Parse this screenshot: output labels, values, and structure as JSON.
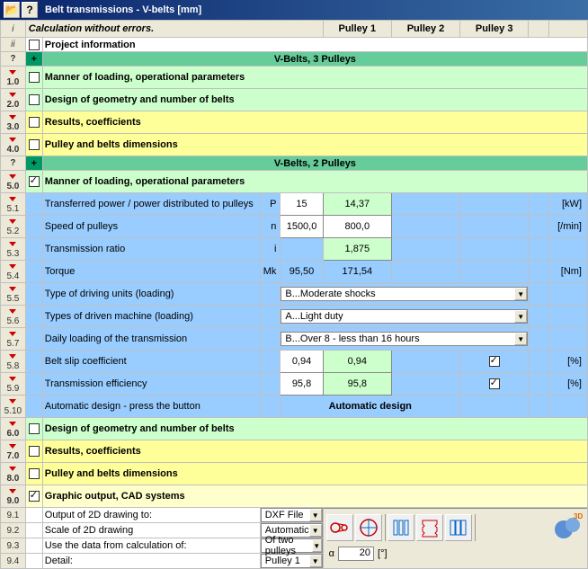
{
  "title": "Belt transmissions - V-belts [mm]",
  "header": {
    "status": "Calculation without errors.",
    "p1": "Pulley 1",
    "p2": "Pulley 2",
    "p3": "Pulley 3",
    "proj": "Project information"
  },
  "section3": "V-Belts, 3 Pulleys",
  "section2": "V-Belts, 2 Pulleys",
  "btn": {
    "help": "?",
    "plus": "+"
  },
  "rows": {
    "r1": "Manner of loading, operational parameters",
    "r2": "Design of geometry and number of belts",
    "r3": "Results, coefficients",
    "r4": "Pulley and belts dimensions",
    "r5": "Manner of loading, operational parameters",
    "r51": "Transferred power / power distributed to pulleys",
    "r52": "Speed of pulleys",
    "r53": "Transmission ratio",
    "r54": "Torque",
    "r55": "Type of driving units (loading)",
    "r56": "Types of driven machine (loading)",
    "r57": "Daily loading of the transmission",
    "r58": "Belt slip coefficient",
    "r59": "Transmission efficiency",
    "r510": "Automatic design - press the button",
    "r6": "Design of geometry and number of belts",
    "r7": "Results, coefficients",
    "r8": "Pulley and belts dimensions",
    "r9": "Graphic output, CAD systems",
    "r91": "Output of 2D drawing to:",
    "r92": "Scale of 2D drawing",
    "r93": "Use the data from calculation of:",
    "r94": "Detail:"
  },
  "sym": {
    "P": "P",
    "n": "n",
    "i": "i",
    "Mk": "Mk",
    "alpha": "α"
  },
  "units": {
    "kw": "[kW]",
    "min": "[/min]",
    "nm": "[Nm]",
    "pct": "[%]",
    "deg": "[°]"
  },
  "vals": {
    "P1": "15",
    "P2": "14,37",
    "n1": "1500,0",
    "n2": "800,0",
    "i2": "1,875",
    "Mk1": "95,50",
    "Mk2": "171,54",
    "slip1": "0,94",
    "slip2": "0,94",
    "eff1": "95,8",
    "eff2": "95,8",
    "alpha": "20"
  },
  "dd": {
    "r55": "B...Moderate shocks",
    "r56": "A...Light duty",
    "r57": "B...Over 8 - less than 16 hours",
    "r91": "DXF File",
    "r92": "Automatic",
    "r93": "Of two pulleys",
    "r94": "Pulley 1"
  },
  "auto_btn": "Automatic design",
  "rownums": {
    "i": "i",
    "ii": "ii",
    "q": "?",
    "r1": "1.0",
    "r2": "2.0",
    "r3": "3.0",
    "r4": "4.0",
    "r5": "5.0",
    "r51": "5.1",
    "r52": "5.2",
    "r53": "5.3",
    "r54": "5.4",
    "r55": "5.5",
    "r56": "5.6",
    "r57": "5.7",
    "r58": "5.8",
    "r59": "5.9",
    "r510": "5.10",
    "r6": "6.0",
    "r7": "7.0",
    "r8": "8.0",
    "r9": "9.0",
    "r91": "9.1",
    "r92": "9.2",
    "r93": "9.3",
    "r94": "9.4"
  }
}
